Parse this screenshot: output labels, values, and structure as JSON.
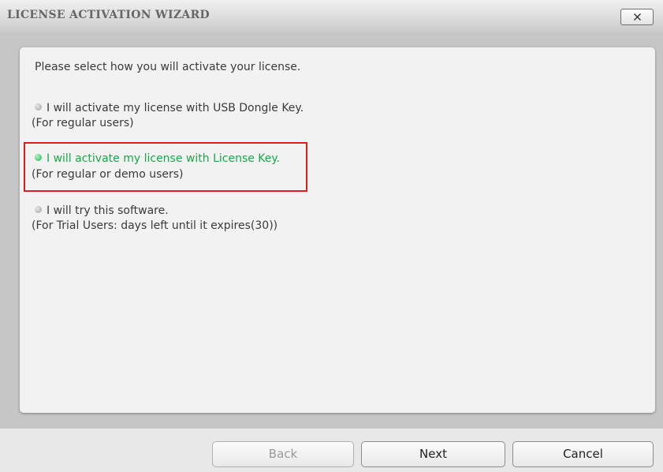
{
  "window": {
    "title": "LICENSE ACTIVATION WIZARD",
    "close_label": "X"
  },
  "prompt": "Please select how you will activate your license.",
  "options": [
    {
      "label": "I will activate my license with USB Dongle Key.",
      "sublabel": "(For regular users)",
      "selected": false
    },
    {
      "label": "I will activate my license with License Key.",
      "sublabel": "(For regular or demo users)",
      "selected": true
    },
    {
      "label": "I will try this software.",
      "sublabel": "(For Trial Users: days left until it expires(30))",
      "selected": false
    }
  ],
  "buttons": {
    "back": "Back",
    "next": "Next",
    "cancel": "Cancel"
  },
  "colors": {
    "selected_text": "#18a849",
    "highlight_border": "#e11b1b",
    "panel_background": "#f2f2f2",
    "window_background": "#c6c6c6"
  }
}
